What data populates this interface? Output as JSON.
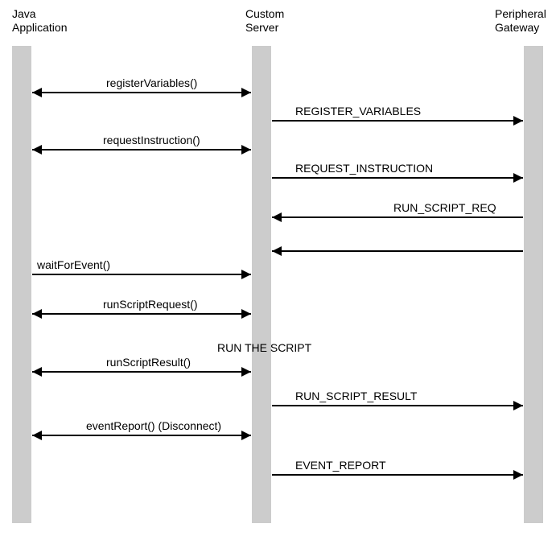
{
  "participants": {
    "java_app": "Java\nApplication",
    "custom_server": "Custom\nServer",
    "peripheral_gateway": "Peripheral\nGateway"
  },
  "messages": {
    "register_variables_call": "registerVariables()",
    "register_variables_msg": "REGISTER_VARIABLES",
    "request_instruction_call": "requestInstruction()",
    "request_instruction_msg": "REQUEST_INSTRUCTION",
    "run_script_req_msg": "RUN_SCRIPT_REQ",
    "wait_for_event_call": "waitForEvent()",
    "run_script_request_call": "runScriptRequest()",
    "run_the_script_note": "RUN THE SCRIPT",
    "run_script_result_call": "runScriptResult()",
    "run_script_result_msg": "RUN_SCRIPT_RESULT",
    "event_report_call": "eventReport() (Disconnect)",
    "event_report_msg": "EVENT_REPORT"
  }
}
